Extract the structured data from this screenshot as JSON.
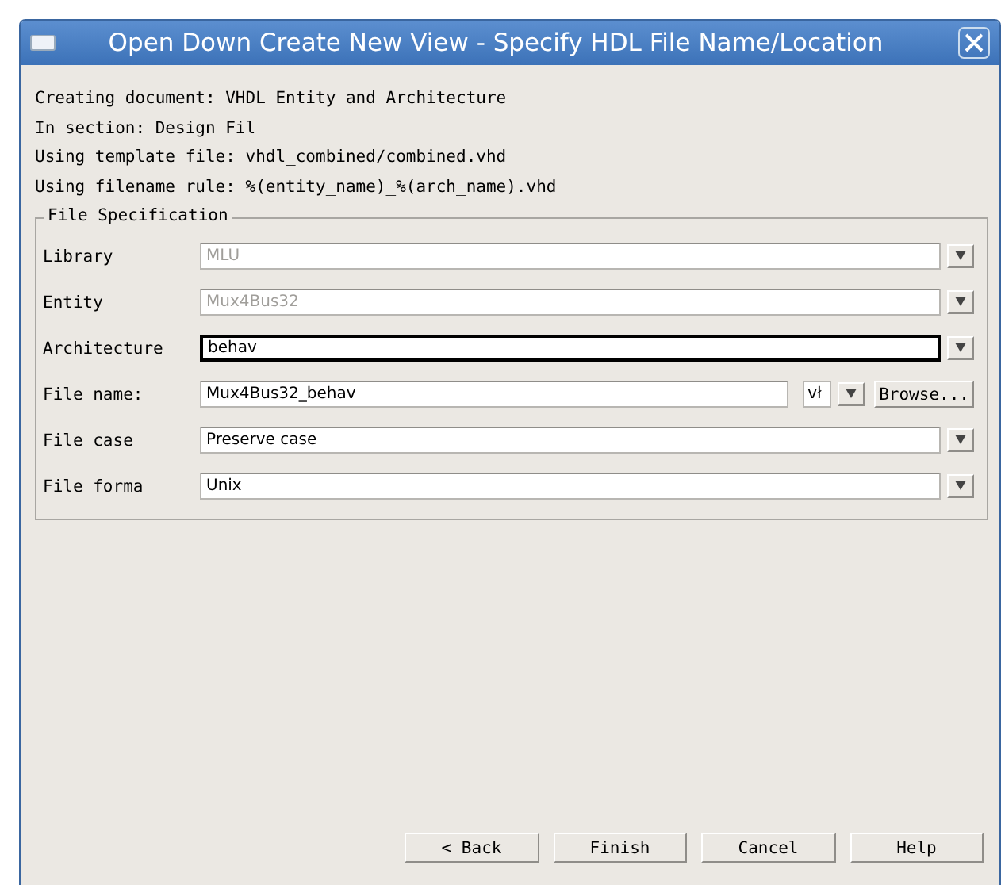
{
  "window": {
    "title": "Open Down Create New View - Specify HDL File Name/Location"
  },
  "info_lines": [
    "Creating document: VHDL Entity and Architecture",
    "In section: Design Fil",
    "Using template file: vhdl_combined/combined.vhd",
    "Using filename rule: %(entity_name)_%(arch_name).vhd"
  ],
  "file_specification": {
    "title": "File Specification",
    "fields": [
      {
        "kind": "combo",
        "label": "Library",
        "value": "MLU",
        "disabled": true,
        "focused": false
      },
      {
        "kind": "combo",
        "label": "Entity",
        "value": "Mux4Bus32",
        "disabled": true,
        "focused": false
      },
      {
        "kind": "combo",
        "label": "Architecture",
        "value": "behav",
        "disabled": false,
        "focused": true
      },
      {
        "kind": "file",
        "label": "File name:",
        "value": "Mux4Bus32_behav",
        "extension": "vł",
        "browse": "Browse...",
        "disabled": false,
        "focused": false
      },
      {
        "kind": "combo",
        "label": "File case",
        "value": "Preserve case",
        "disabled": false,
        "focused": false
      },
      {
        "kind": "combo",
        "label": "File forma",
        "value": "Unix",
        "disabled": false,
        "focused": false
      }
    ]
  },
  "buttons": [
    "< Back",
    "Finish",
    "Cancel",
    "Help"
  ]
}
